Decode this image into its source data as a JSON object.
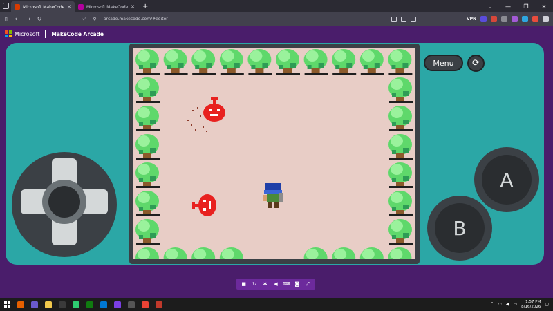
{
  "browser": {
    "tabs": [
      {
        "title": "Microsoft MakeCode Arcade",
        "color": "#d83b01",
        "active": true
      },
      {
        "title": "Microsoft MakeCode - Bring co",
        "color": "#b4009e",
        "active": false
      }
    ],
    "new_tab": "+",
    "url": "arcade.makecode.com/#editor",
    "vpn_label": "VPN",
    "window_controls": [
      "⌄",
      "—",
      "❐",
      "✕"
    ]
  },
  "header": {
    "brand": "Microsoft",
    "product": "MakeCode Arcade",
    "logo_colors": [
      "#f25022",
      "#7fba00",
      "#00a4ef",
      "#ffb900"
    ]
  },
  "simulator": {
    "menu_label": "Menu",
    "restart_icon": "restart-icon",
    "a_label": "A",
    "b_label": "B",
    "toolbar_icons": [
      {
        "name": "stop-icon",
        "glyph": "■"
      },
      {
        "name": "restart-icon",
        "glyph": "↻"
      },
      {
        "name": "debug-icon",
        "glyph": "✱"
      },
      {
        "name": "mute-icon",
        "glyph": "◀"
      },
      {
        "name": "keyboard-icon",
        "glyph": "⌨"
      },
      {
        "name": "screenshot-icon",
        "glyph": "◙"
      },
      {
        "name": "fullscreen-icon",
        "glyph": "⤢"
      }
    ]
  },
  "taskbar": {
    "time": "1:57 PM",
    "date": "8/16/2026"
  },
  "colors": {
    "console": "#2ba7a6",
    "header_bg": "#4a1d6b",
    "screen_bg": "#e8cdc6",
    "enemy": "#e8211f",
    "player": "#1f3fa8"
  }
}
